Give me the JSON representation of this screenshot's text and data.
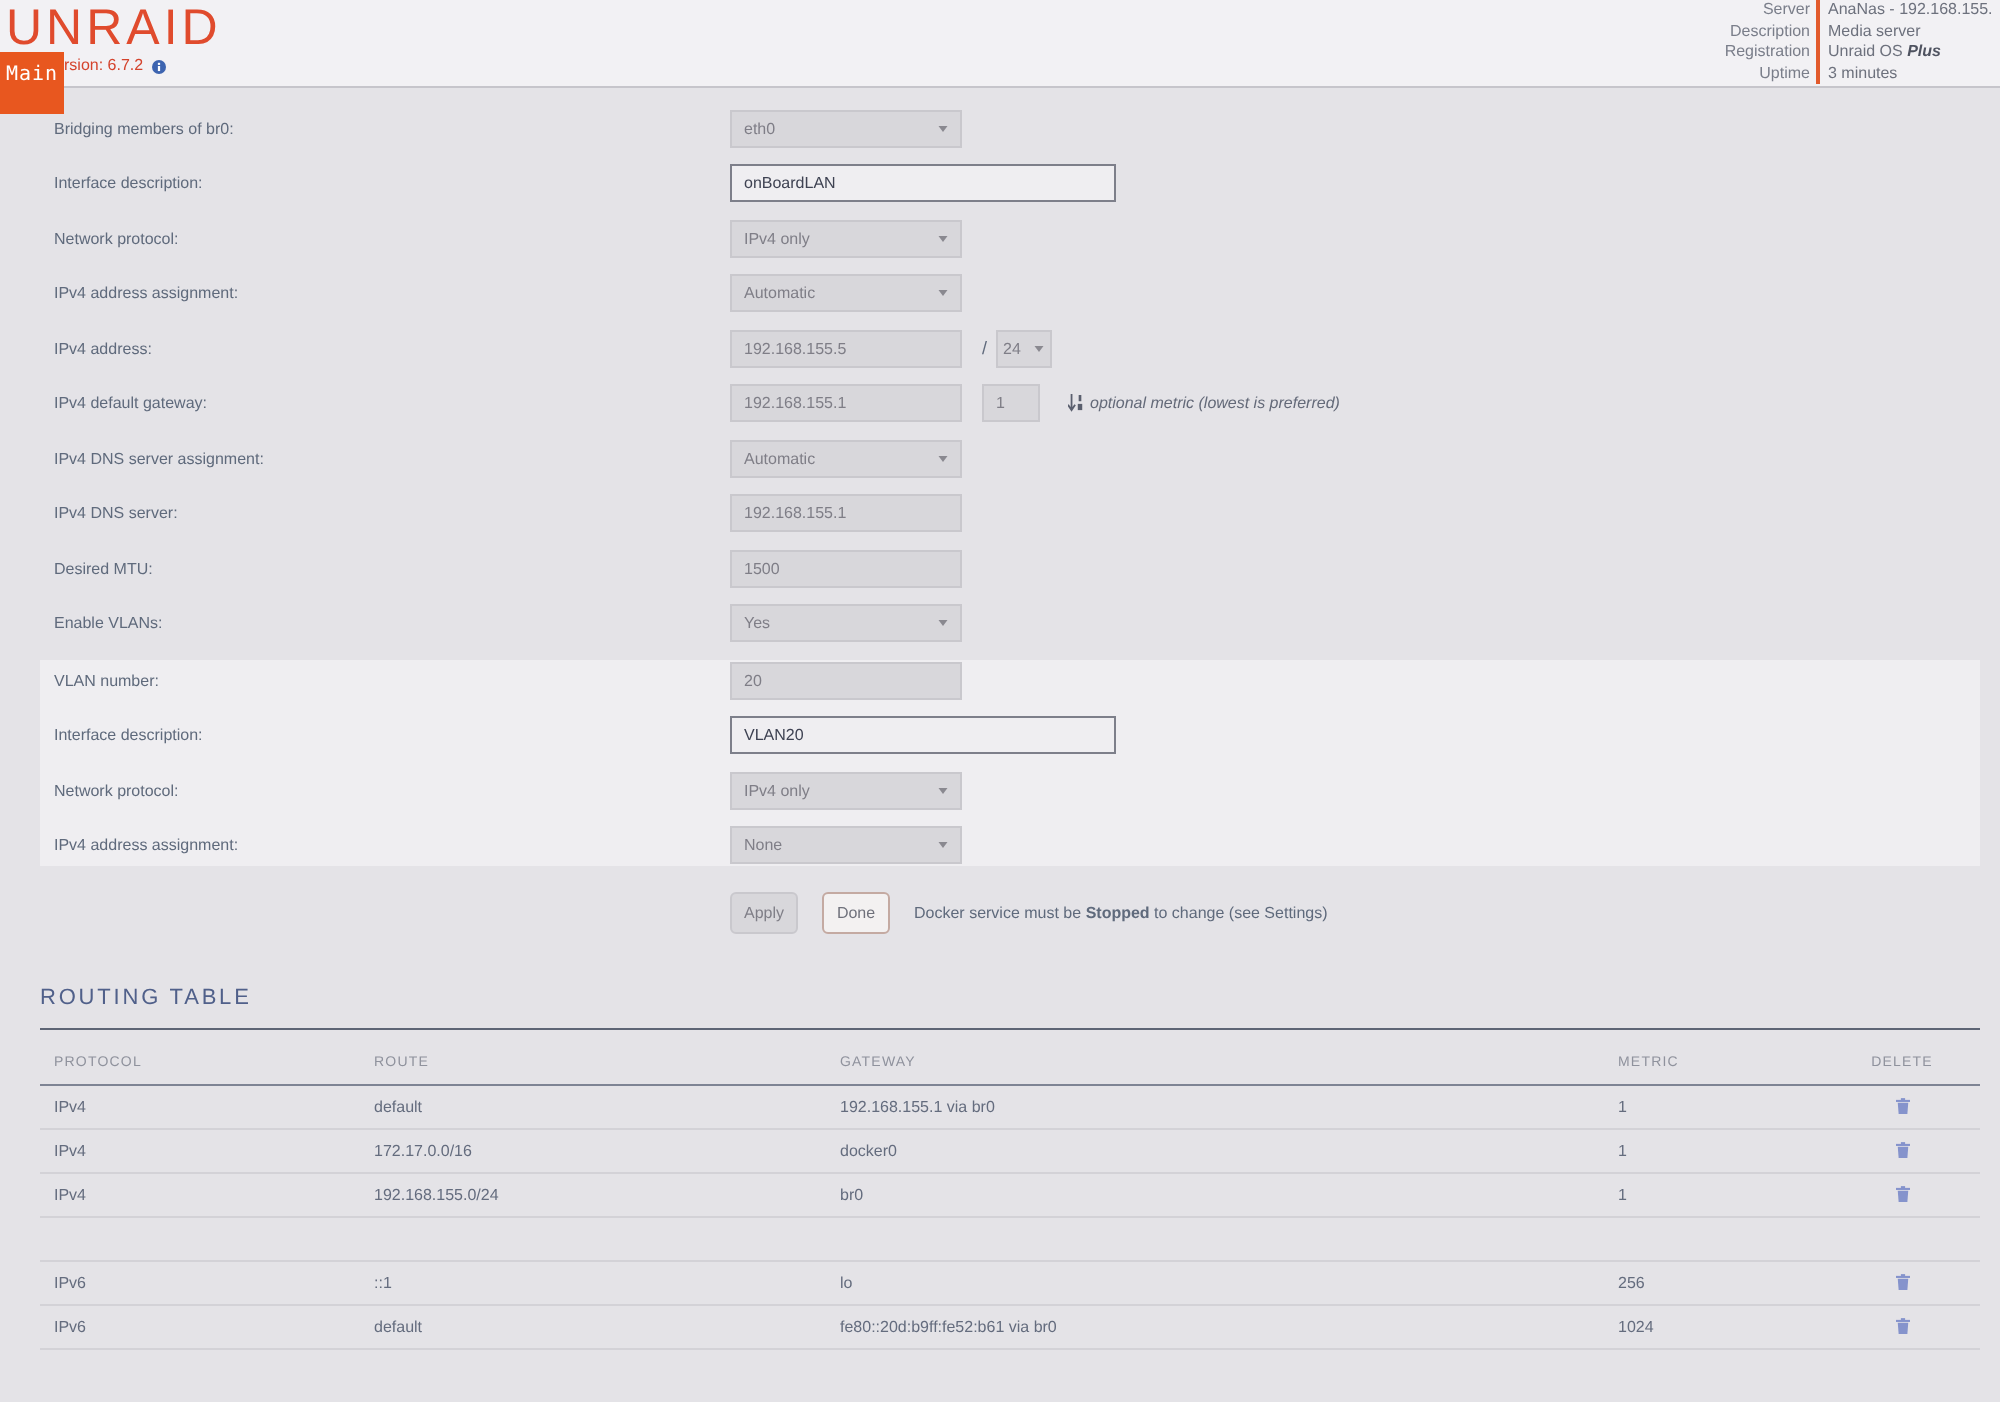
{
  "header": {
    "logo": "UNRAID",
    "version": "rsion: 6.7.2",
    "main_tab": {
      "label": "Main",
      "selected": true
    },
    "server_info": [
      {
        "label": "Server",
        "value": "AnaNas - 192.168.155."
      },
      {
        "label": "Description",
        "value": "Media server"
      },
      {
        "label": "Registration",
        "value": "Unraid OS **Plus**"
      },
      {
        "label": "Uptime",
        "value": "3 minutes"
      }
    ]
  },
  "form": {
    "sections": [
      {
        "kind": "plain",
        "rows": [
          {
            "label": "Bridging members of br0:",
            "controls": [
              {
                "kind": "select",
                "value": "eth0",
                "disabled": true
              }
            ]
          },
          {
            "label": "Interface description:",
            "controls": [
              {
                "kind": "wideinput",
                "value": "onBoardLAN",
                "disabled": false
              }
            ]
          },
          {
            "label": "Network protocol:",
            "controls": [
              {
                "kind": "select",
                "value": "IPv4 only",
                "disabled": true
              }
            ]
          },
          {
            "label": "IPv4 address assignment:",
            "controls": [
              {
                "kind": "select",
                "value": "Automatic",
                "disabled": true
              }
            ]
          },
          {
            "label": "IPv4 address:",
            "controls": [
              {
                "kind": "input",
                "value": "192.168.155.5",
                "disabled": true
              },
              {
                "kind": "separator",
                "value": "/"
              },
              {
                "kind": "smallselect",
                "value": "24",
                "disabled": true
              }
            ]
          },
          {
            "label": "IPv4 default gateway:",
            "controls": [
              {
                "kind": "input",
                "value": "192.168.155.1",
                "disabled": true
              },
              {
                "kind": "smallinput",
                "value": "1",
                "disabled": true
              },
              {
                "kind": "hint",
                "value": "optional metric (lowest is preferred)"
              }
            ]
          },
          {
            "label": "IPv4 DNS server assignment:",
            "controls": [
              {
                "kind": "select",
                "value": "Automatic",
                "disabled": true
              }
            ]
          },
          {
            "label": "IPv4 DNS server:",
            "controls": [
              {
                "kind": "input",
                "value": "192.168.155.1",
                "disabled": true
              }
            ]
          },
          {
            "label": "Desired MTU:",
            "controls": [
              {
                "kind": "input",
                "value": "1500",
                "disabled": true
              }
            ]
          },
          {
            "label": "Enable VLANs:",
            "controls": [
              {
                "kind": "select",
                "value": "Yes",
                "disabled": true
              }
            ]
          }
        ]
      },
      {
        "kind": "panel",
        "rows": [
          {
            "label": "VLAN number:",
            "controls": [
              {
                "kind": "input",
                "value": "20",
                "disabled": true
              }
            ]
          },
          {
            "label": "Interface description:",
            "controls": [
              {
                "kind": "wideinput",
                "value": "VLAN20",
                "disabled": false
              }
            ]
          },
          {
            "label": "Network protocol:",
            "controls": [
              {
                "kind": "select",
                "value": "IPv4 only",
                "disabled": true
              }
            ]
          },
          {
            "label": "IPv4 address assignment:",
            "controls": [
              {
                "kind": "select",
                "value": "None",
                "disabled": true
              }
            ]
          }
        ]
      }
    ],
    "buttons": [
      {
        "label": "Apply",
        "disabled": true
      },
      {
        "label": "Done",
        "disabled": false
      }
    ],
    "note": "Docker service must be **Stopped** to change (see Settings)"
  },
  "routing": {
    "title": "ROUTING TABLE",
    "columns": [
      "PROTOCOL",
      "ROUTE",
      "GATEWAY",
      "METRIC",
      "DELETE"
    ],
    "groups": [
      {
        "rows": [
          {
            "cells": [
              "IPv4",
              "default",
              "192.168.155.1 via br0",
              "1"
            ]
          },
          {
            "cells": [
              "IPv4",
              "172.17.0.0/16",
              "docker0",
              "1"
            ]
          },
          {
            "cells": [
              "IPv4",
              "192.168.155.0/24",
              "br0",
              "1"
            ]
          }
        ]
      },
      {
        "rows": [
          {
            "cells": [
              "IPv6",
              "::1",
              "lo",
              "256"
            ]
          },
          {
            "cells": [
              "IPv6",
              "default",
              "fe80::20d:b9ff:fe52:b61 via br0",
              "1024"
            ]
          }
        ]
      }
    ]
  }
}
